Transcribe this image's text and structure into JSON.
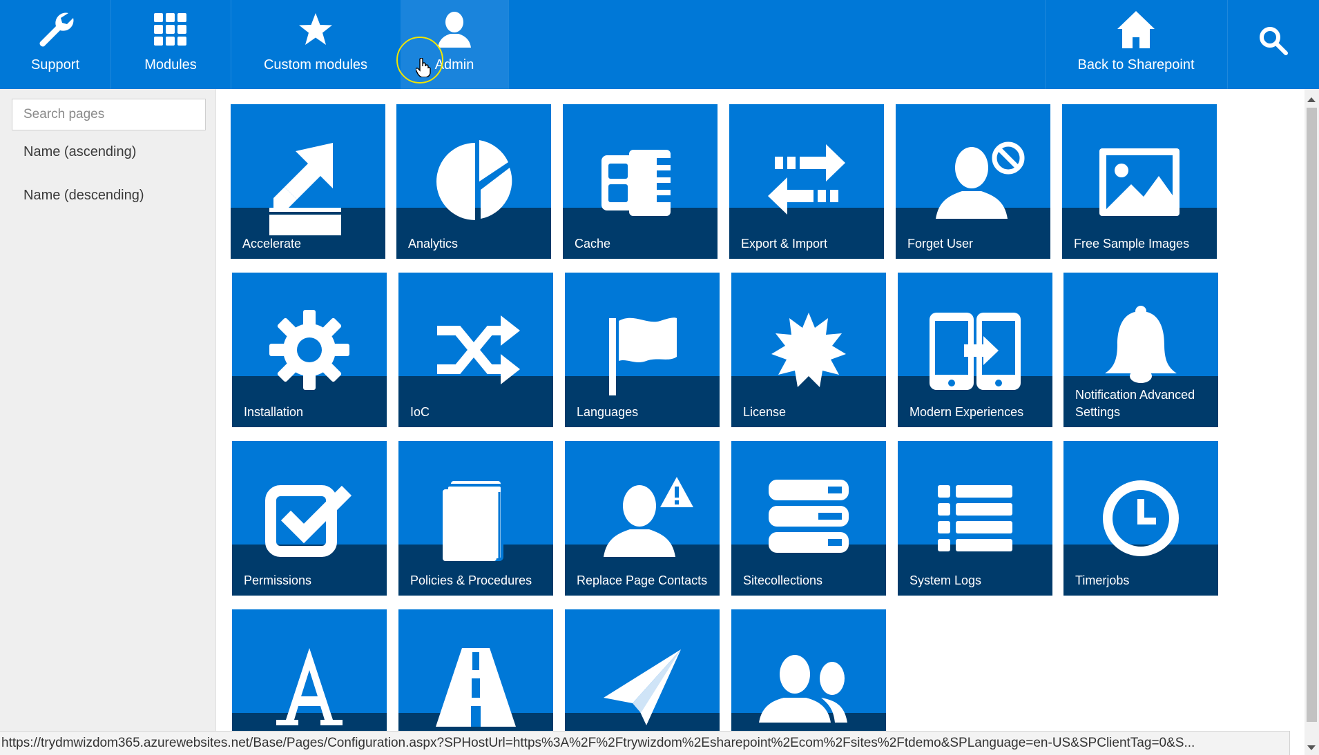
{
  "nav": {
    "items": [
      {
        "label": "Support",
        "icon": "wrench-icon"
      },
      {
        "label": "Modules",
        "icon": "grid-icon"
      },
      {
        "label": "Custom modules",
        "icon": "star-icon"
      },
      {
        "label": "Admin",
        "icon": "user-icon"
      }
    ],
    "back": {
      "label": "Back to Sharepoint",
      "icon": "home-icon"
    },
    "search_icon": "search-icon",
    "active_item": "Admin"
  },
  "sidebar": {
    "search_placeholder": "Search pages",
    "sort_options": [
      "Name (ascending)",
      "Name (descending)"
    ]
  },
  "tiles": [
    {
      "label": "Accelerate",
      "icon": "arrow-line-icon"
    },
    {
      "label": "Analytics",
      "icon": "pie-chart-icon"
    },
    {
      "label": "Cache",
      "icon": "memory-icon"
    },
    {
      "label": "Export & Import",
      "icon": "exchange-icon"
    },
    {
      "label": "Forget User",
      "icon": "user-blocked-icon"
    },
    {
      "label": "Free Sample Images",
      "icon": "image-icon"
    },
    {
      "label": "Installation",
      "icon": "gear-icon"
    },
    {
      "label": "IoC",
      "icon": "shuffle-icon"
    },
    {
      "label": "Languages",
      "icon": "flag-icon"
    },
    {
      "label": "License",
      "icon": "certificate-icon"
    },
    {
      "label": "Modern Experiences",
      "icon": "migrate-icon"
    },
    {
      "label": "Notification Advanced Settings",
      "icon": "bell-icon"
    },
    {
      "label": "Permissions",
      "icon": "checkbox-icon"
    },
    {
      "label": "Policies & Procedures",
      "icon": "book-icon"
    },
    {
      "label": "Replace Page Contacts",
      "icon": "user-warning-icon"
    },
    {
      "label": "Sitecollections",
      "icon": "server-icon"
    },
    {
      "label": "System Logs",
      "icon": "list-icon"
    },
    {
      "label": "Timerjobs",
      "icon": "clock-icon"
    },
    {
      "label": "",
      "icon": "font-icon"
    },
    {
      "label": "",
      "icon": "road-icon"
    },
    {
      "label": "",
      "icon": "paper-plane-icon"
    },
    {
      "label": "",
      "icon": "users-icon"
    }
  ],
  "status_bar": {
    "url": "https://trydmwizdom365.azurewebsites.net/Base/Pages/Configuration.aspx?SPHostUrl=https%3A%2F%2Ftrywizdom%2Esharepoint%2Ecom%2Fsites%2Ftdemo&SPLanguage=en-US&SPClientTag=0&S..."
  },
  "colors": {
    "nav_bg": "#0078d7",
    "tile_bg": "#0078d7",
    "tile_band": "#003b6b",
    "sidebar_bg": "#efefef",
    "cursor_ring": "#f0e400"
  }
}
